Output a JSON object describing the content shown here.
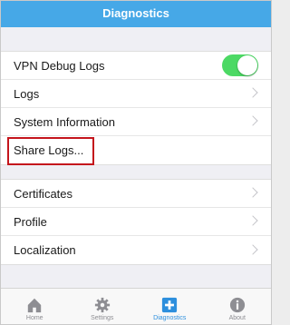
{
  "navbar": {
    "title": "Diagnostics"
  },
  "settings_group_1": {
    "items": [
      {
        "label": "VPN Debug Logs",
        "control": "toggle",
        "toggle_on": true
      },
      {
        "label": "Logs",
        "control": "chevron"
      },
      {
        "label": "System Information",
        "control": "chevron"
      },
      {
        "label": "Share Logs...",
        "control": "none",
        "highlighted": true
      }
    ]
  },
  "settings_group_2": {
    "items": [
      {
        "label": "Certificates",
        "control": "chevron"
      },
      {
        "label": "Profile",
        "control": "chevron"
      },
      {
        "label": "Localization",
        "control": "chevron"
      }
    ]
  },
  "tabbar": {
    "tabs": [
      {
        "label": "Home",
        "icon": "home-icon",
        "active": false
      },
      {
        "label": "Settings",
        "icon": "gear-icon",
        "active": false
      },
      {
        "label": "Diagnostics",
        "icon": "plus-icon",
        "active": true
      },
      {
        "label": "About",
        "icon": "info-icon",
        "active": false
      }
    ]
  },
  "colors": {
    "navbar_bg": "#46a8e7",
    "toggle_on": "#4cd964",
    "active_tab": "#2d8fdd",
    "highlight_border": "#c4151c"
  }
}
